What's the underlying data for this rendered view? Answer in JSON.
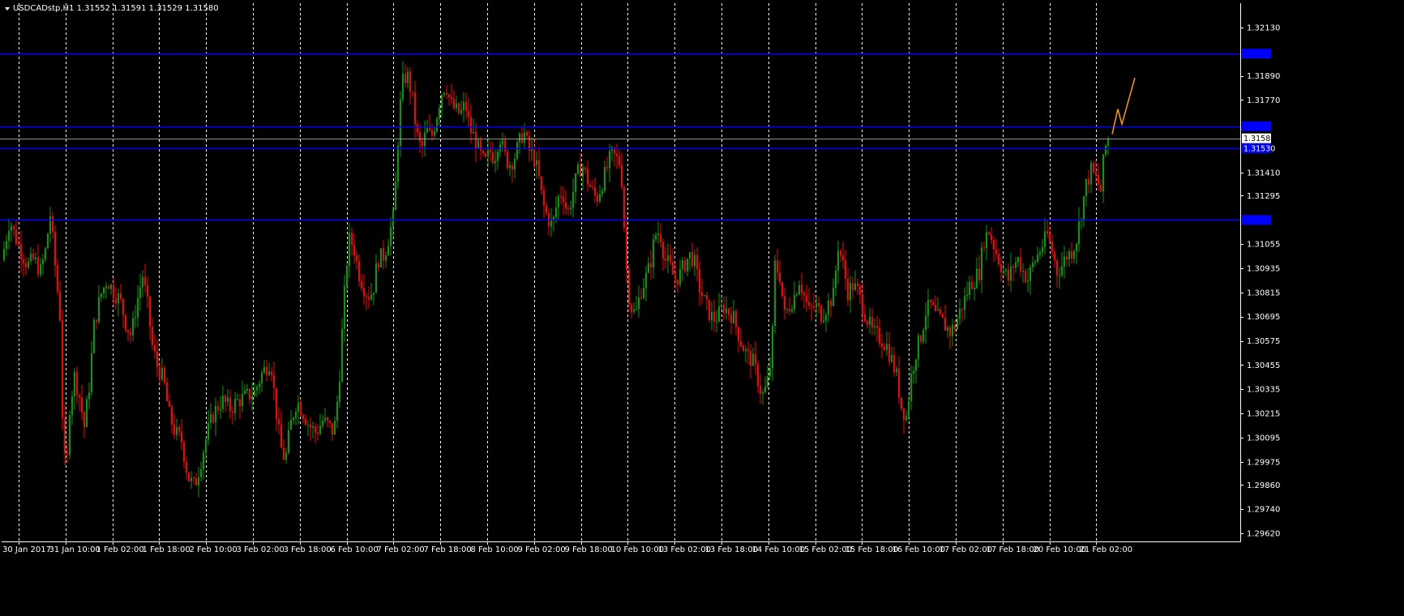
{
  "header": {
    "triangle_icon": "chevron-down-icon",
    "text": "USDCADstp,H1  1.31552 1.31591 1.31529 1.31580"
  },
  "colors": {
    "background": "#000000",
    "foreground": "#ffffff",
    "grid": "#ffffff",
    "bull": "#00a000",
    "bear": "#ff0000",
    "level_line": "#0000ff",
    "bid_line": "#c0c0c0",
    "projection": "#ff9900"
  },
  "chart_data": {
    "type": "candlestick",
    "symbol": "USDCADstp",
    "timeframe": "H1",
    "ohlc": {
      "open": 1.31552,
      "high": 1.31591,
      "low": 1.31529,
      "close": 1.3158
    },
    "ylim": [
      1.2958,
      1.3225
    ],
    "y_ticks": [
      "1.32130",
      "1.31890",
      "1.31770",
      "1.31410",
      "1.31295",
      "1.31055",
      "1.30935",
      "1.30815",
      "1.30695",
      "1.30575",
      "1.30455",
      "1.30335",
      "1.30215",
      "1.30095",
      "1.29975",
      "1.29860",
      "1.29740",
      "1.29620"
    ],
    "x_labels": [
      "30 Jan 2017",
      "31 Jan 10:00",
      "1 Feb 02:00",
      "1 Feb 18:00",
      "2 Feb 10:00",
      "3 Feb 02:00",
      "3 Feb 18:00",
      "6 Feb 10:00",
      "7 Feb 02:00",
      "7 Feb 18:00",
      "8 Feb 10:00",
      "9 Feb 02:00",
      "9 Feb 18:00",
      "10 Feb 10:00",
      "13 Feb 02:00",
      "13 Feb 18:00",
      "14 Feb 10:00",
      "15 Feb 02:00",
      "15 Feb 18:00",
      "16 Feb 10:00",
      "17 Feb 02:00",
      "17 Feb 18:00",
      "20 Feb 10:00",
      "21 Feb 02:00"
    ],
    "grid": true,
    "horizontal_levels": [
      {
        "price": 1.32,
        "label": ""
      },
      {
        "price": 1.3164,
        "label": ""
      },
      {
        "price": 1.3153,
        "label": "1.31530"
      },
      {
        "price": 1.31175,
        "label": ""
      }
    ],
    "current_price": {
      "price": 1.3158,
      "label": "1.31580"
    },
    "price_path": [
      {
        "x": 0,
        "y": 1.309
      },
      {
        "x": 8,
        "y": 1.3105
      },
      {
        "x": 14,
        "y": 1.3118
      },
      {
        "x": 20,
        "y": 1.311
      },
      {
        "x": 28,
        "y": 1.3102
      },
      {
        "x": 36,
        "y": 1.3095
      },
      {
        "x": 44,
        "y": 1.3098
      },
      {
        "x": 52,
        "y": 1.3092
      },
      {
        "x": 58,
        "y": 1.3102
      },
      {
        "x": 64,
        "y": 1.312
      },
      {
        "x": 70,
        "y": 1.3095
      },
      {
        "x": 76,
        "y": 1.307
      },
      {
        "x": 80,
        "y": 1.3005
      },
      {
        "x": 84,
        "y": 1.299
      },
      {
        "x": 88,
        "y": 1.3025
      },
      {
        "x": 94,
        "y": 1.304
      },
      {
        "x": 100,
        "y": 1.303
      },
      {
        "x": 106,
        "y": 1.3015
      },
      {
        "x": 112,
        "y": 1.3035
      },
      {
        "x": 118,
        "y": 1.3065
      },
      {
        "x": 126,
        "y": 1.308
      },
      {
        "x": 134,
        "y": 1.3088
      },
      {
        "x": 142,
        "y": 1.3082
      },
      {
        "x": 150,
        "y": 1.3078
      },
      {
        "x": 158,
        "y": 1.3065
      },
      {
        "x": 164,
        "y": 1.306
      },
      {
        "x": 170,
        "y": 1.3075
      },
      {
        "x": 178,
        "y": 1.309
      },
      {
        "x": 184,
        "y": 1.3075
      },
      {
        "x": 190,
        "y": 1.3055
      },
      {
        "x": 196,
        "y": 1.3045
      },
      {
        "x": 204,
        "y": 1.3038
      },
      {
        "x": 210,
        "y": 1.3022
      },
      {
        "x": 218,
        "y": 1.3012
      },
      {
        "x": 226,
        "y": 1.3008
      },
      {
        "x": 234,
        "y": 1.299
      },
      {
        "x": 242,
        "y": 1.2985
      },
      {
        "x": 250,
        "y": 1.2998
      },
      {
        "x": 258,
        "y": 1.3012
      },
      {
        "x": 266,
        "y": 1.3022
      },
      {
        "x": 276,
        "y": 1.3028
      },
      {
        "x": 286,
        "y": 1.3024
      },
      {
        "x": 296,
        "y": 1.3028
      },
      {
        "x": 306,
        "y": 1.303
      },
      {
        "x": 316,
        "y": 1.3032
      },
      {
        "x": 326,
        "y": 1.3042
      },
      {
        "x": 336,
        "y": 1.3048
      },
      {
        "x": 342,
        "y": 1.3025
      },
      {
        "x": 348,
        "y": 1.3005
      },
      {
        "x": 354,
        "y": 1.2998
      },
      {
        "x": 360,
        "y": 1.3015
      },
      {
        "x": 368,
        "y": 1.3028
      },
      {
        "x": 376,
        "y": 1.3022
      },
      {
        "x": 384,
        "y": 1.3015
      },
      {
        "x": 392,
        "y": 1.3012
      },
      {
        "x": 400,
        "y": 1.3018
      },
      {
        "x": 408,
        "y": 1.3015
      },
      {
        "x": 414,
        "y": 1.3012
      },
      {
        "x": 420,
        "y": 1.3035
      },
      {
        "x": 426,
        "y": 1.3075
      },
      {
        "x": 432,
        "y": 1.3108
      },
      {
        "x": 438,
        "y": 1.3105
      },
      {
        "x": 444,
        "y": 1.3092
      },
      {
        "x": 450,
        "y": 1.3085
      },
      {
        "x": 456,
        "y": 1.308
      },
      {
        "x": 462,
        "y": 1.3082
      },
      {
        "x": 468,
        "y": 1.3098
      },
      {
        "x": 476,
        "y": 1.31
      },
      {
        "x": 482,
        "y": 1.311
      },
      {
        "x": 488,
        "y": 1.312
      },
      {
        "x": 494,
        "y": 1.3165
      },
      {
        "x": 498,
        "y": 1.3185
      },
      {
        "x": 504,
        "y": 1.319
      },
      {
        "x": 510,
        "y": 1.318
      },
      {
        "x": 516,
        "y": 1.316
      },
      {
        "x": 522,
        "y": 1.3152
      },
      {
        "x": 528,
        "y": 1.3162
      },
      {
        "x": 534,
        "y": 1.3158
      },
      {
        "x": 540,
        "y": 1.3168
      },
      {
        "x": 546,
        "y": 1.318
      },
      {
        "x": 552,
        "y": 1.3185
      },
      {
        "x": 558,
        "y": 1.3175
      },
      {
        "x": 564,
        "y": 1.3172
      },
      {
        "x": 570,
        "y": 1.317
      },
      {
        "x": 576,
        "y": 1.3175
      },
      {
        "x": 582,
        "y": 1.3162
      },
      {
        "x": 588,
        "y": 1.3158
      },
      {
        "x": 594,
        "y": 1.315
      },
      {
        "x": 600,
        "y": 1.3145
      },
      {
        "x": 606,
        "y": 1.3152
      },
      {
        "x": 612,
        "y": 1.3148
      },
      {
        "x": 618,
        "y": 1.316
      },
      {
        "x": 624,
        "y": 1.315
      },
      {
        "x": 630,
        "y": 1.3145
      },
      {
        "x": 636,
        "y": 1.3148
      },
      {
        "x": 642,
        "y": 1.3155
      },
      {
        "x": 648,
        "y": 1.3162
      },
      {
        "x": 654,
        "y": 1.3152
      },
      {
        "x": 660,
        "y": 1.315
      },
      {
        "x": 666,
        "y": 1.314
      },
      {
        "x": 672,
        "y": 1.3125
      },
      {
        "x": 678,
        "y": 1.3118
      },
      {
        "x": 684,
        "y": 1.3115
      },
      {
        "x": 690,
        "y": 1.3128
      },
      {
        "x": 696,
        "y": 1.3132
      },
      {
        "x": 702,
        "y": 1.312
      },
      {
        "x": 708,
        "y": 1.313
      },
      {
        "x": 714,
        "y": 1.314
      },
      {
        "x": 720,
        "y": 1.3145
      },
      {
        "x": 726,
        "y": 1.3138
      },
      {
        "x": 732,
        "y": 1.3132
      },
      {
        "x": 738,
        "y": 1.3128
      },
      {
        "x": 744,
        "y": 1.3135
      },
      {
        "x": 750,
        "y": 1.3142
      },
      {
        "x": 756,
        "y": 1.315
      },
      {
        "x": 762,
        "y": 1.3148
      },
      {
        "x": 768,
        "y": 1.3145
      },
      {
        "x": 772,
        "y": 1.3115
      },
      {
        "x": 776,
        "y": 1.3085
      },
      {
        "x": 780,
        "y": 1.3075
      },
      {
        "x": 786,
        "y": 1.307
      },
      {
        "x": 792,
        "y": 1.3082
      },
      {
        "x": 798,
        "y": 1.3088
      },
      {
        "x": 804,
        "y": 1.3095
      },
      {
        "x": 810,
        "y": 1.311
      },
      {
        "x": 816,
        "y": 1.3112
      },
      {
        "x": 822,
        "y": 1.3098
      },
      {
        "x": 828,
        "y": 1.3095
      },
      {
        "x": 834,
        "y": 1.3088
      },
      {
        "x": 840,
        "y": 1.309
      },
      {
        "x": 846,
        "y": 1.3095
      },
      {
        "x": 852,
        "y": 1.31
      },
      {
        "x": 858,
        "y": 1.3098
      },
      {
        "x": 864,
        "y": 1.3085
      },
      {
        "x": 870,
        "y": 1.3078
      },
      {
        "x": 876,
        "y": 1.3072
      },
      {
        "x": 882,
        "y": 1.3068
      },
      {
        "x": 888,
        "y": 1.307
      },
      {
        "x": 894,
        "y": 1.3075
      },
      {
        "x": 900,
        "y": 1.3072
      },
      {
        "x": 906,
        "y": 1.307
      },
      {
        "x": 912,
        "y": 1.3062
      },
      {
        "x": 918,
        "y": 1.3055
      },
      {
        "x": 924,
        "y": 1.305
      },
      {
        "x": 930,
        "y": 1.3048
      },
      {
        "x": 936,
        "y": 1.304
      },
      {
        "x": 942,
        "y": 1.303
      },
      {
        "x": 948,
        "y": 1.3035
      },
      {
        "x": 954,
        "y": 1.305
      },
      {
        "x": 958,
        "y": 1.3095
      },
      {
        "x": 964,
        "y": 1.309
      },
      {
        "x": 970,
        "y": 1.307
      },
      {
        "x": 976,
        "y": 1.3075
      },
      {
        "x": 982,
        "y": 1.308
      },
      {
        "x": 988,
        "y": 1.3088
      },
      {
        "x": 994,
        "y": 1.308
      },
      {
        "x": 1000,
        "y": 1.3072
      },
      {
        "x": 1008,
        "y": 1.3075
      },
      {
        "x": 1016,
        "y": 1.307
      },
      {
        "x": 1024,
        "y": 1.3076
      },
      {
        "x": 1030,
        "y": 1.308
      },
      {
        "x": 1036,
        "y": 1.3105
      },
      {
        "x": 1042,
        "y": 1.3095
      },
      {
        "x": 1048,
        "y": 1.3082
      },
      {
        "x": 1054,
        "y": 1.3085
      },
      {
        "x": 1060,
        "y": 1.3082
      },
      {
        "x": 1066,
        "y": 1.3075
      },
      {
        "x": 1072,
        "y": 1.3068
      },
      {
        "x": 1078,
        "y": 1.3062
      },
      {
        "x": 1084,
        "y": 1.306
      },
      {
        "x": 1090,
        "y": 1.3058
      },
      {
        "x": 1096,
        "y": 1.3055
      },
      {
        "x": 1102,
        "y": 1.3048
      },
      {
        "x": 1108,
        "y": 1.304
      },
      {
        "x": 1114,
        "y": 1.3025
      },
      {
        "x": 1120,
        "y": 1.302
      },
      {
        "x": 1126,
        "y": 1.304
      },
      {
        "x": 1132,
        "y": 1.3052
      },
      {
        "x": 1138,
        "y": 1.306
      },
      {
        "x": 1144,
        "y": 1.3072
      },
      {
        "x": 1150,
        "y": 1.3075
      },
      {
        "x": 1156,
        "y": 1.307
      },
      {
        "x": 1162,
        "y": 1.3068
      },
      {
        "x": 1168,
        "y": 1.3065
      },
      {
        "x": 1174,
        "y": 1.3062
      },
      {
        "x": 1180,
        "y": 1.3065
      },
      {
        "x": 1186,
        "y": 1.3072
      },
      {
        "x": 1192,
        "y": 1.3078
      },
      {
        "x": 1198,
        "y": 1.3085
      },
      {
        "x": 1204,
        "y": 1.3088
      },
      {
        "x": 1210,
        "y": 1.3092
      },
      {
        "x": 1216,
        "y": 1.3108
      },
      {
        "x": 1222,
        "y": 1.3112
      },
      {
        "x": 1228,
        "y": 1.3105
      },
      {
        "x": 1234,
        "y": 1.3098
      },
      {
        "x": 1240,
        "y": 1.3092
      },
      {
        "x": 1246,
        "y": 1.3088
      },
      {
        "x": 1252,
        "y": 1.3095
      },
      {
        "x": 1258,
        "y": 1.3098
      },
      {
        "x": 1264,
        "y": 1.3092
      },
      {
        "x": 1270,
        "y": 1.3088
      },
      {
        "x": 1276,
        "y": 1.3095
      },
      {
        "x": 1282,
        "y": 1.31
      },
      {
        "x": 1288,
        "y": 1.3105
      },
      {
        "x": 1294,
        "y": 1.311
      },
      {
        "x": 1300,
        "y": 1.3102
      },
      {
        "x": 1306,
        "y": 1.3092
      },
      {
        "x": 1312,
        "y": 1.3095
      },
      {
        "x": 1318,
        "y": 1.31
      },
      {
        "x": 1324,
        "y": 1.3102
      },
      {
        "x": 1330,
        "y": 1.3108
      },
      {
        "x": 1336,
        "y": 1.3122
      },
      {
        "x": 1342,
        "y": 1.3135
      },
      {
        "x": 1348,
        "y": 1.3142
      },
      {
        "x": 1354,
        "y": 1.3138
      },
      {
        "x": 1360,
        "y": 1.3132
      },
      {
        "x": 1364,
        "y": 1.315
      },
      {
        "x": 1368,
        "y": 1.3158
      }
    ],
    "projection_path": [
      {
        "x": 1372,
        "y": 1.316
      },
      {
        "x": 1379,
        "y": 1.31725
      },
      {
        "x": 1384,
        "y": 1.3165
      },
      {
        "x": 1400,
        "y": 1.3188
      }
    ]
  }
}
